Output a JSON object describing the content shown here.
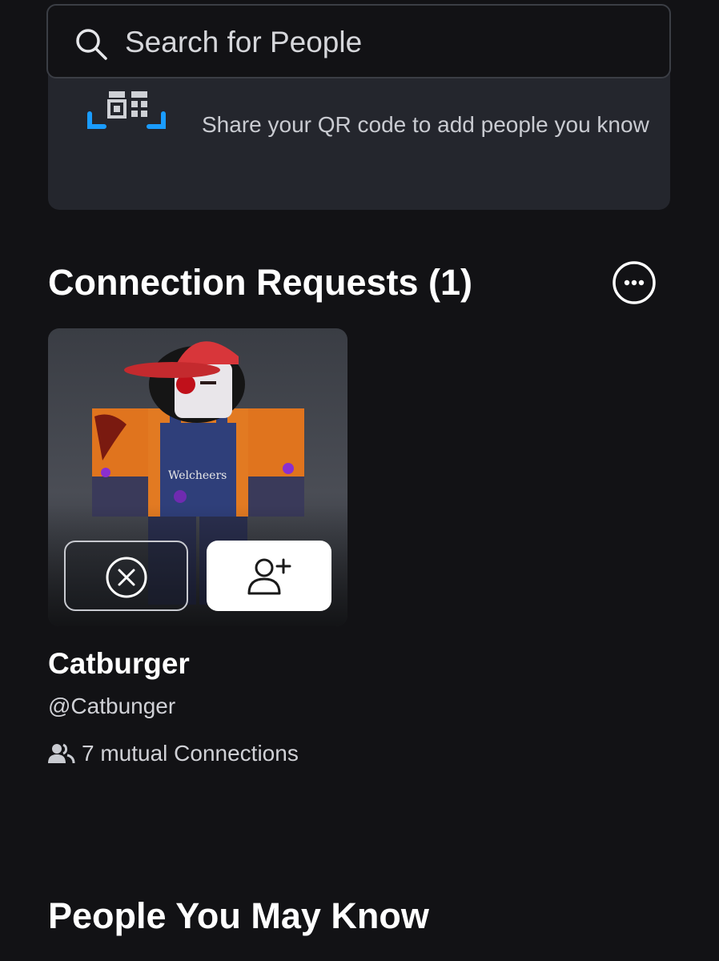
{
  "search": {
    "placeholder": "Search for People"
  },
  "qr_card": {
    "description": "Share your QR code to add people you know",
    "accent_color": "#1a9cff"
  },
  "connection_requests": {
    "title": "Connection Requests (1)",
    "more_icon": "ellipsis-circle-icon",
    "requests": [
      {
        "display_name": "Catburger",
        "username": "@Catbunger",
        "mutual": "7 mutual Connections",
        "avatar_shirt_text": "Welcheers",
        "decline_icon": "x-circle-icon",
        "accept_icon": "add-user-icon"
      }
    ]
  },
  "people_you_may_know": {
    "title": "People You May Know"
  },
  "colors": {
    "background": "#121215",
    "card": "#24262d",
    "text_primary": "#ffffff",
    "text_secondary": "#d0d1d6"
  }
}
